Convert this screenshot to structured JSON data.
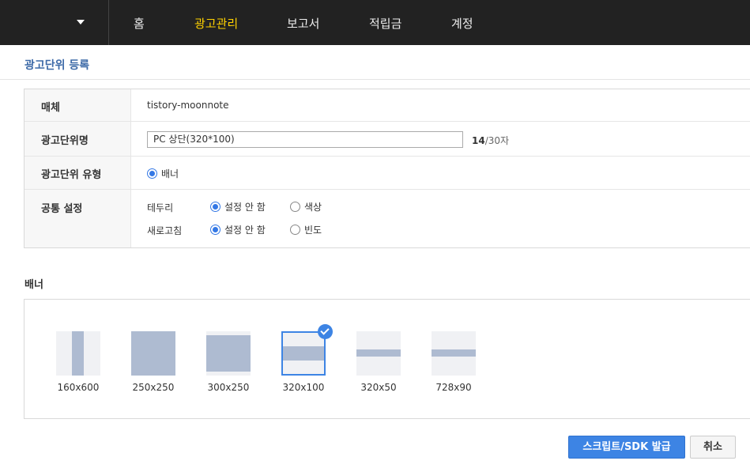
{
  "nav": {
    "items": [
      {
        "label": "홈",
        "active": false
      },
      {
        "label": "광고관리",
        "active": true
      },
      {
        "label": "보고서",
        "active": false
      },
      {
        "label": "적립금",
        "active": false
      },
      {
        "label": "계정",
        "active": false
      }
    ],
    "active_color": "#ffd200"
  },
  "page": {
    "title": "광고단위 등록"
  },
  "form": {
    "media": {
      "label": "매체",
      "value": "tistory-moonnote"
    },
    "unit_name": {
      "label": "광고단위명",
      "value": "PC 상단(320*100)",
      "count": "14",
      "max": "/30자"
    },
    "unit_type": {
      "label": "광고단위 유형",
      "option": "배너"
    },
    "common": {
      "label": "공통 설정",
      "border": {
        "label": "테두리",
        "options": [
          "설정 안 함",
          "색상"
        ],
        "selected": "설정 안 함"
      },
      "refresh": {
        "label": "새로고침",
        "options": [
          "설정 안 함",
          "빈도"
        ],
        "selected": "설정 안 함"
      }
    }
  },
  "banner_section": {
    "title": "배너",
    "sizes": [
      "160x600",
      "250x250",
      "300x250",
      "320x100",
      "320x50",
      "728x90"
    ],
    "selected": "320x100"
  },
  "buttons": {
    "submit": "스크립트/SDK 발급",
    "cancel": "취소"
  },
  "colors": {
    "accent": "#3d84e4",
    "title": "#3d6aa8",
    "topbar": "#222222"
  }
}
